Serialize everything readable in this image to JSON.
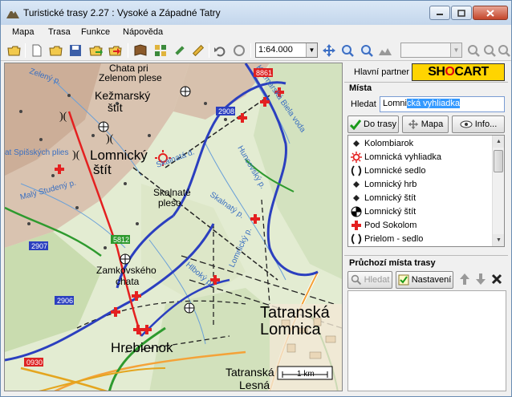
{
  "window": {
    "title": "Turistické trasy 2.27 : Vysoké a Západné Tatry"
  },
  "menu": [
    "Mapa",
    "Trasa",
    "Funkce",
    "Nápověda"
  ],
  "toolbar": {
    "scale": "1:64.000",
    "secondary_select": ""
  },
  "partner": {
    "label": "Hlavní partner",
    "logo": {
      "part1": "SH",
      "part2": "O",
      "part3": "CART"
    }
  },
  "places": {
    "title": "Místa",
    "search_label": "Hledat",
    "search_typed": "Lomni",
    "search_selected": "cká vyhliadka",
    "buttons": {
      "route": "Do trasy",
      "map": "Mapa",
      "info": "Info..."
    },
    "items": [
      {
        "icon": "dot-icon",
        "label": "Kolombiarok"
      },
      {
        "icon": "viewpoint-icon",
        "label": "Lomnická vyhliadka"
      },
      {
        "icon": "saddle-icon",
        "label": "Lomnické sedlo"
      },
      {
        "icon": "dot-icon",
        "label": "Lomnický hrb"
      },
      {
        "icon": "dot-icon",
        "label": "Lomnický štít"
      },
      {
        "icon": "peak-icon",
        "label": "Lomnický štít"
      },
      {
        "icon": "cross-icon",
        "label": "Pod Sokolom"
      },
      {
        "icon": "saddle-icon",
        "label": "Prielom - sedlo"
      }
    ]
  },
  "route_points": {
    "title": "Průchozí místa trasy",
    "search_button": "Hledat",
    "settings_button": "Nastavení"
  },
  "map": {
    "labels": {
      "chata_pri": "Chata pri",
      "zelenom_plese": "Zelenom plese",
      "kezmarsky": "Kežmarský",
      "stit1": "štít",
      "lomnicky": "Lomnický",
      "stit2": "štít",
      "skalnate_plesi_a": "Skalnaté",
      "skalnate_plesi_b": "pleso",
      "zamkovskeho": "Zamkovského",
      "chata": "chata",
      "hrebienok": "Hrebienok",
      "tatranska": "Tatranská",
      "lomnica": "Lomnica",
      "tatranska2": "Tatranská",
      "lesna": "Lesná",
      "scale_bar": "1 km",
      "spisskych": "at Spišských plies",
      "studeny": "Malý Studený p.",
      "skalnaty": "Skalnatý p.",
      "hunovsky": "Huncovský p.",
      "zeleny": "Zelený p.",
      "hlboky": "Hlboký p.",
      "skalnata_dolina": "Skalnatá d.",
      "kezmarska_biela": "Kežmarská Biela voda",
      "lomnicky_p": "Lomnický p.",
      "h2908": "2908",
      "h2907": "2907",
      "h2906": "2906",
      "h5812": "5812",
      "h0930": "0930",
      "h8861": "8861"
    }
  }
}
